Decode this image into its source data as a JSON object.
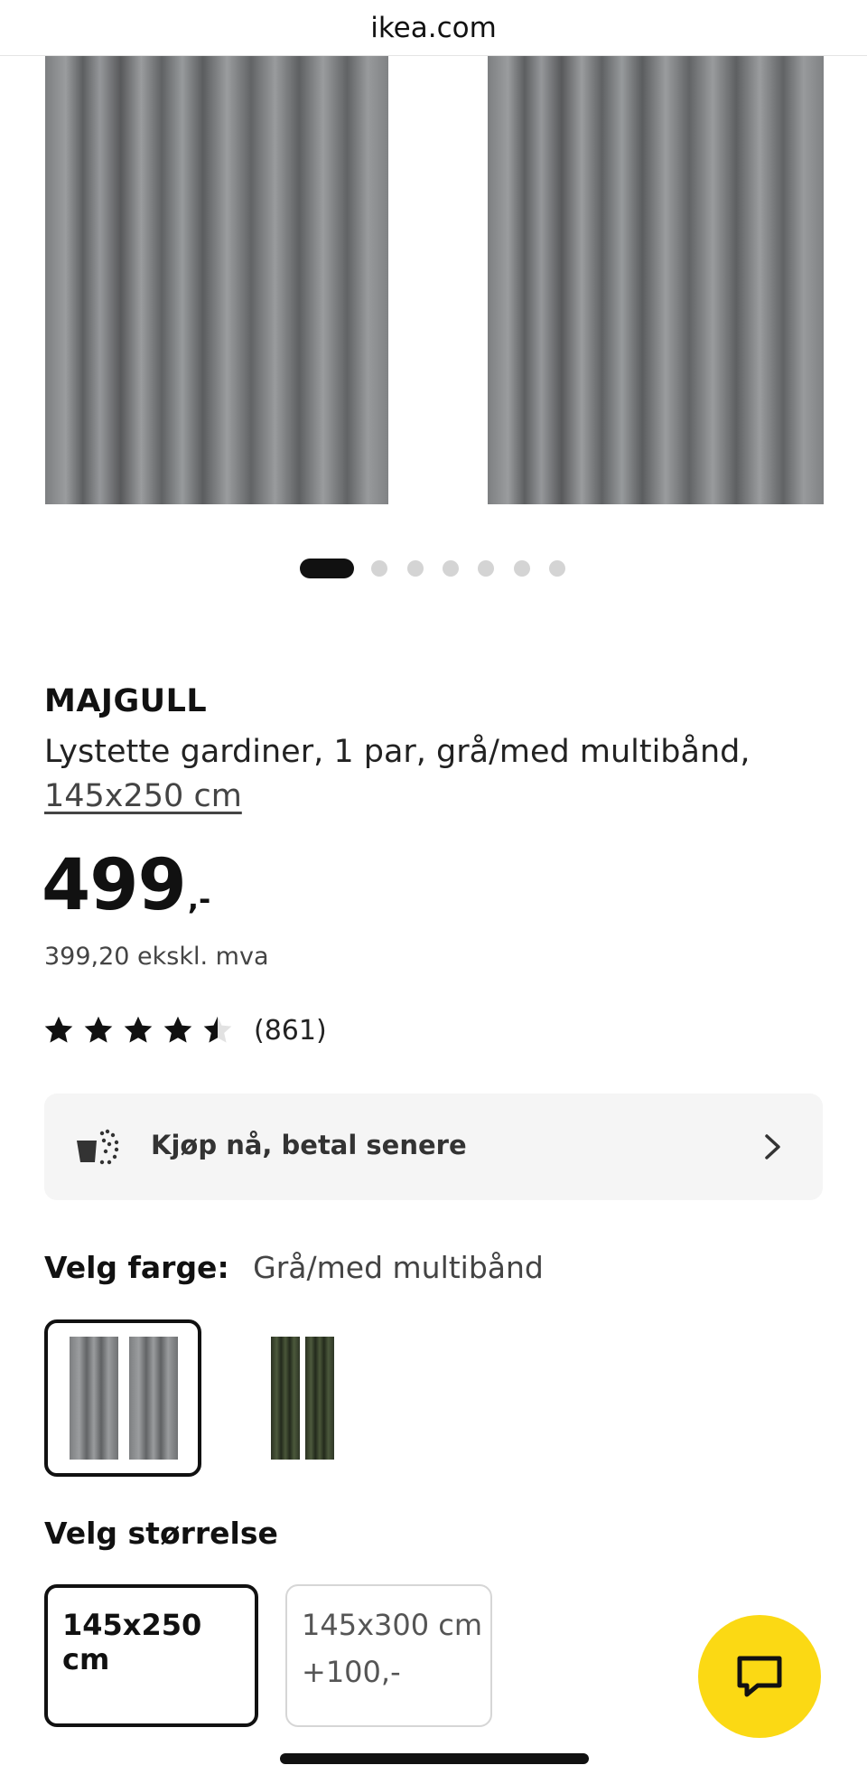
{
  "browser": {
    "url": "ikea.com"
  },
  "gallery": {
    "image_count": 7,
    "active_index": 0,
    "image_alt": "curtain-pair-image"
  },
  "product": {
    "name": "MAJGULL",
    "description": "Lystette gardiner, 1 par, grå/med multibånd,",
    "size_link": "145x250 cm",
    "price_int": "499",
    "price_dec": ",-",
    "price_ex_vat": "399,20 ekskl. mva",
    "rating": 4.5,
    "rating_count": "(861)"
  },
  "bnpl": {
    "label": "Kjøp nå, betal senere",
    "icon": "cart-dotted-icon"
  },
  "color": {
    "label": "Velg farge:",
    "value": "Grå/med multibånd",
    "options": [
      {
        "name": "grey",
        "color": "#8f9193",
        "selected": true
      },
      {
        "name": "dark-green",
        "color": "#3b4530",
        "selected": false
      }
    ]
  },
  "size": {
    "label": "Velg størrelse",
    "options": [
      {
        "size": "145x250 cm",
        "price": "",
        "selected": true
      },
      {
        "size": "145x300 cm",
        "price": "+100,-",
        "selected": false
      }
    ]
  },
  "colors": {
    "accent": "#fbd914",
    "text": "#111111",
    "muted": "#444444"
  }
}
